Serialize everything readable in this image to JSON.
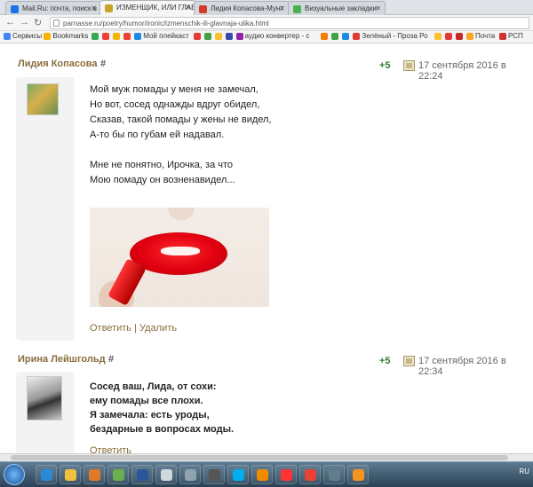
{
  "browser": {
    "tabs": [
      {
        "label": "Mail.Ru: почта, поиск в",
        "color": "#1a73e8"
      },
      {
        "label": "ИЗМЕНЩИК, ИЛИ ГЛАВ",
        "color": "#c9a227"
      },
      {
        "label": "Лидия Копасова-Мунт",
        "color": "#d23c2a"
      },
      {
        "label": "Визуальные закладки",
        "color": "#4caf50"
      }
    ],
    "url": "parnasse.ru/poetry/humor/ironic/izmenschik-ili-glavnaja-ulika.html",
    "bookmarks": [
      {
        "label": "Сервисы",
        "color": "#4285f4"
      },
      {
        "label": "Bookmarks",
        "color": "#f4b400"
      },
      {
        "label": "",
        "color": "#34a853"
      },
      {
        "label": "",
        "color": "#ea4335"
      },
      {
        "label": "",
        "color": "#f4b400"
      },
      {
        "label": "",
        "color": "#ea4335"
      },
      {
        "label": "Мой плейкаст",
        "color": "#1e88e5"
      },
      {
        "label": "",
        "color": "#e53935"
      },
      {
        "label": "",
        "color": "#43a047"
      },
      {
        "label": "",
        "color": "#fbc02d"
      },
      {
        "label": "",
        "color": "#3949ab"
      },
      {
        "label": "аудио конвертер - c",
        "color": "#8e24aa"
      },
      {
        "label": "",
        "color": "#f57c00"
      },
      {
        "label": "",
        "color": "#43a047"
      },
      {
        "label": "",
        "color": "#1e88e5"
      },
      {
        "label": "Зелёный - Проза Ро",
        "color": "#e53935"
      },
      {
        "label": "",
        "color": "#fbc02d"
      },
      {
        "label": "",
        "color": "#e53935"
      },
      {
        "label": "",
        "color": "#c62828"
      },
      {
        "label": "Почта",
        "color": "#f9a825"
      },
      {
        "label": "РСП",
        "color": "#d32f2f"
      }
    ]
  },
  "comments": [
    {
      "author": "Лидия Копасова",
      "hash": "#",
      "rating": "+5",
      "date": "17 сентября 2016 в 22:24",
      "text": "Мой муж помады у меня не замечал,\nНо вот, сосед однажды вдруг обидел,\nСказав, такой помады у жены не видел,\nА-то бы по губам ей надавал.\n\nМне не понятно, Ирочка, за что\nМою помаду он возненавидел...",
      "reply": "Ответить",
      "separator": "|",
      "delete": "Удалить"
    },
    {
      "author": "Ирина Лейшгольд",
      "hash": "#",
      "rating": "+5",
      "date": "17 сентября 2016 в 22:34",
      "text": "Сосед ваш, Лида, от сохи:\nему помады все плохи.\nЯ замечала: есть уроды,\nбездарные в вопросах моды.",
      "reply": "Ответить"
    }
  ],
  "taskbar": {
    "lang": "RU",
    "icons": [
      {
        "name": "ie",
        "color": "#2a8ad4"
      },
      {
        "name": "folder",
        "color": "#f0c040"
      },
      {
        "name": "media",
        "color": "#e07a2a"
      },
      {
        "name": "paint",
        "color": "#6ab04c"
      },
      {
        "name": "word",
        "color": "#2b579a"
      },
      {
        "name": "notepad",
        "color": "#cfd8dc"
      },
      {
        "name": "photo",
        "color": "#90a4ae"
      },
      {
        "name": "mic",
        "color": "#555555"
      },
      {
        "name": "skype",
        "color": "#00aff0"
      },
      {
        "name": "vlc",
        "color": "#f08a00"
      },
      {
        "name": "yandex",
        "color": "#ff3333"
      },
      {
        "name": "chrome",
        "color": "#e94235"
      },
      {
        "name": "tool",
        "color": "#607d8b"
      },
      {
        "name": "ok",
        "color": "#f7931e"
      }
    ]
  }
}
